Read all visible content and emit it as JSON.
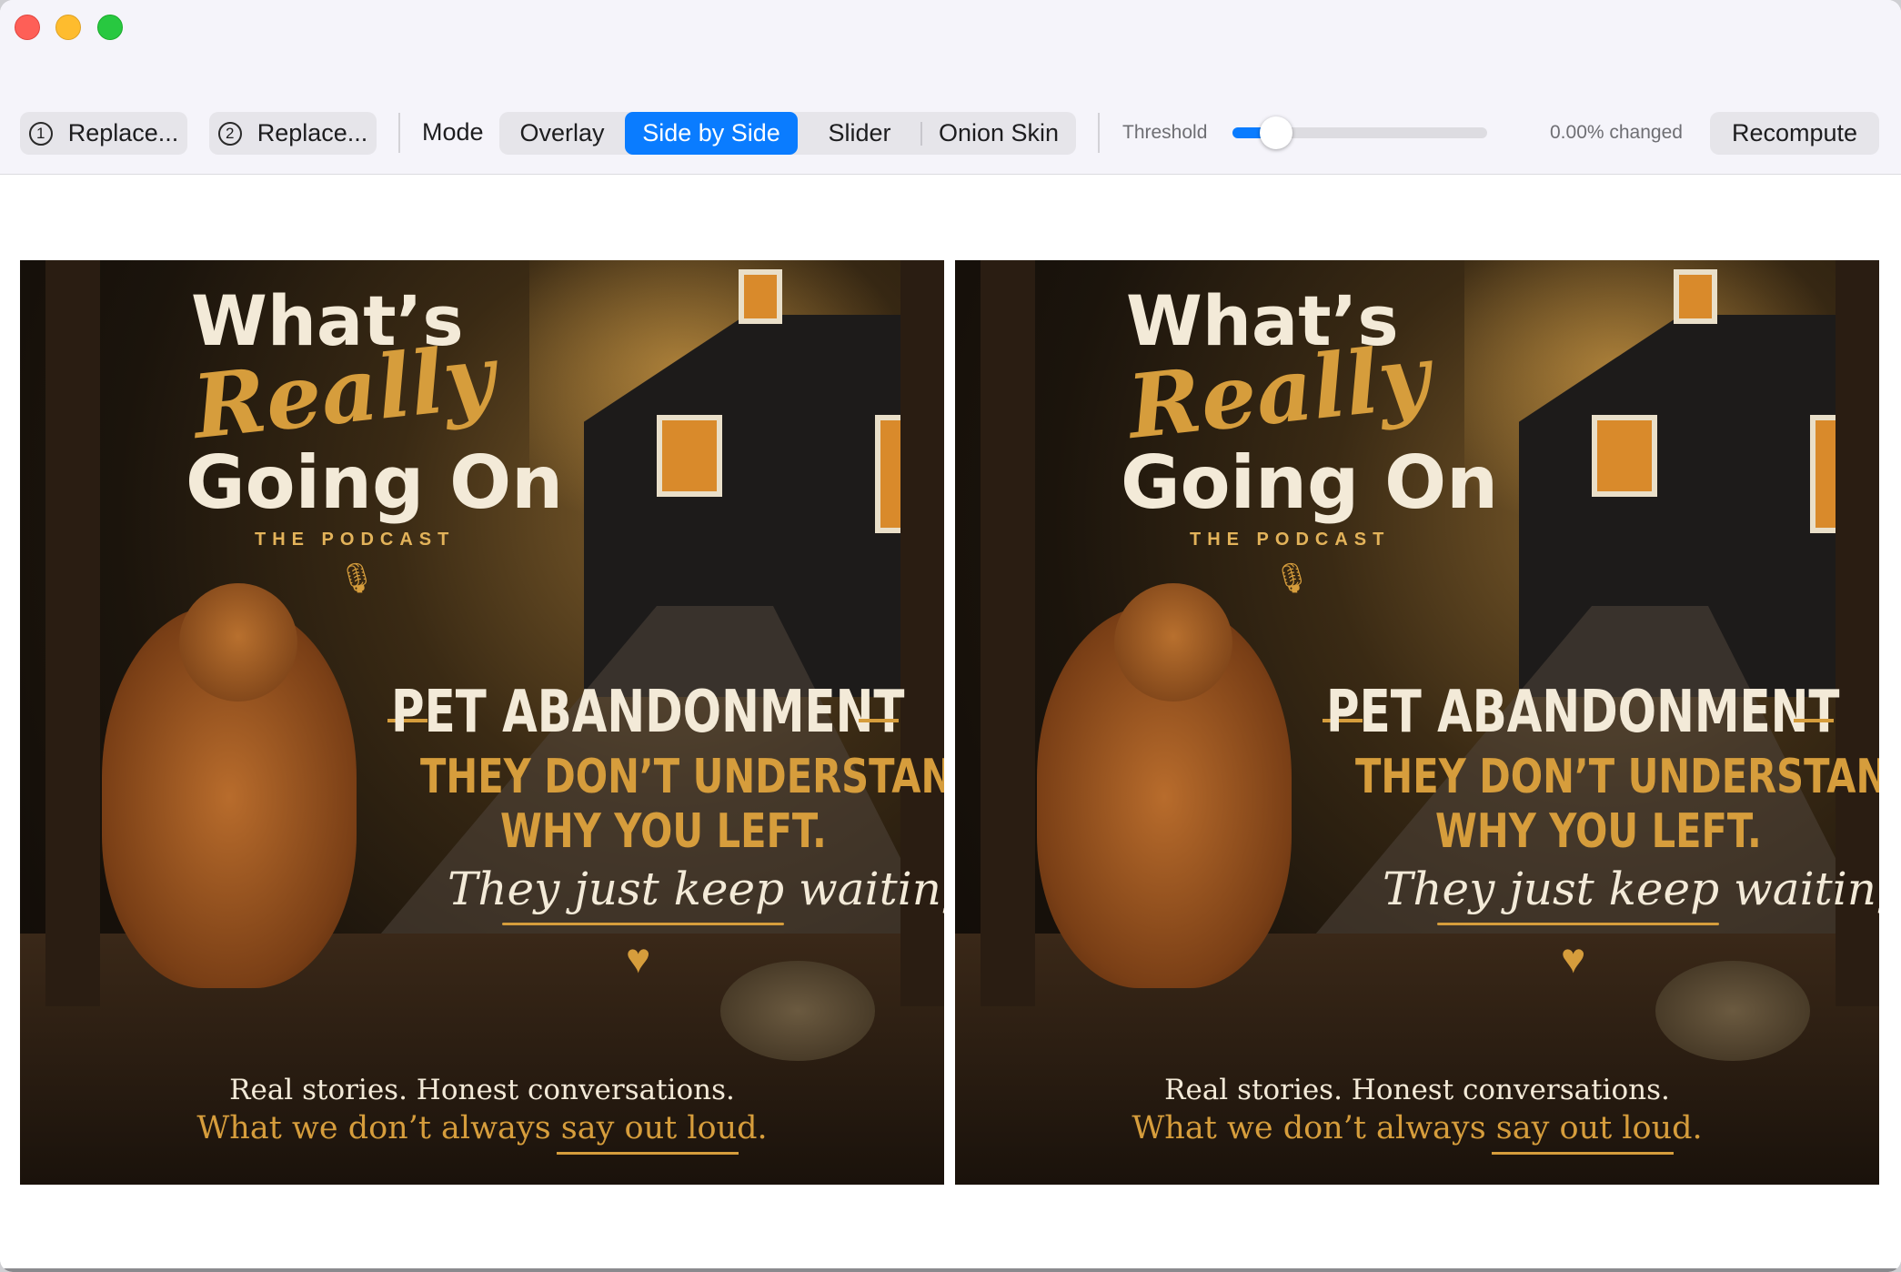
{
  "toolbar": {
    "replace1": {
      "num": "1",
      "label": "Replace..."
    },
    "replace2": {
      "num": "2",
      "label": "Replace..."
    },
    "mode_label": "Mode",
    "modes": [
      "Overlay",
      "Side by Side",
      "Slider",
      "Onion Skin"
    ],
    "active_mode": "Side by Side",
    "threshold_label": "Threshold",
    "threshold_value": 0.17,
    "changed_text": "0.00% changed",
    "recompute_label": "Recompute",
    "accent_color": "#0a7cff"
  },
  "poster": {
    "title_line1": "What’s",
    "title_line2": "Really",
    "title_line3": "Going On",
    "subtitle": "THE PODCAST",
    "mic_icon": "microphone-icon",
    "topic": "PET ABANDONMENT",
    "line1": "THEY DON’T UNDERSTAND",
    "line2": "WHY YOU LEFT.",
    "script_line": "They just keep waiting.",
    "heart_icon": "heart-icon",
    "tagline1": "Real stories. Honest conversations.",
    "tagline2": "What we don’t always say out loud."
  }
}
